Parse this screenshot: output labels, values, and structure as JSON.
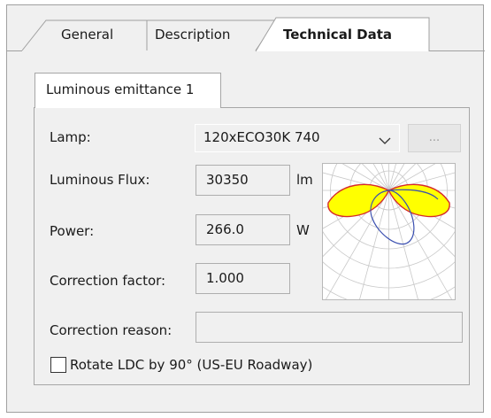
{
  "tabs": [
    {
      "label": "General",
      "active": false
    },
    {
      "label": "Description",
      "active": false
    },
    {
      "label": "Technical Data",
      "active": true
    }
  ],
  "subtab": {
    "label": "Luminous emittance 1"
  },
  "form": {
    "lamp_label": "Lamp:",
    "lamp_value": "120xECO30K 740",
    "browse_label": "...",
    "flux_label": "Luminous Flux:",
    "flux_value": "30350",
    "flux_unit": "lm",
    "power_label": "Power:",
    "power_value": "266.0",
    "power_unit": "W",
    "correction_factor_label": "Correction factor:",
    "correction_factor_value": "1.000",
    "correction_reason_label": "Correction reason:",
    "correction_reason_value": "",
    "rotate_label": "Rotate LDC by 90° (US-EU Roadway)",
    "rotate_checked": false
  },
  "colors": {
    "ldc_fill": "#ffff00",
    "ldc_c0": "#d62a2a",
    "ldc_c90": "#3a4fb0",
    "ldc_grid": "#c8c8c8"
  },
  "icons": {
    "lamp_dropdown": "chevron-down-icon"
  }
}
